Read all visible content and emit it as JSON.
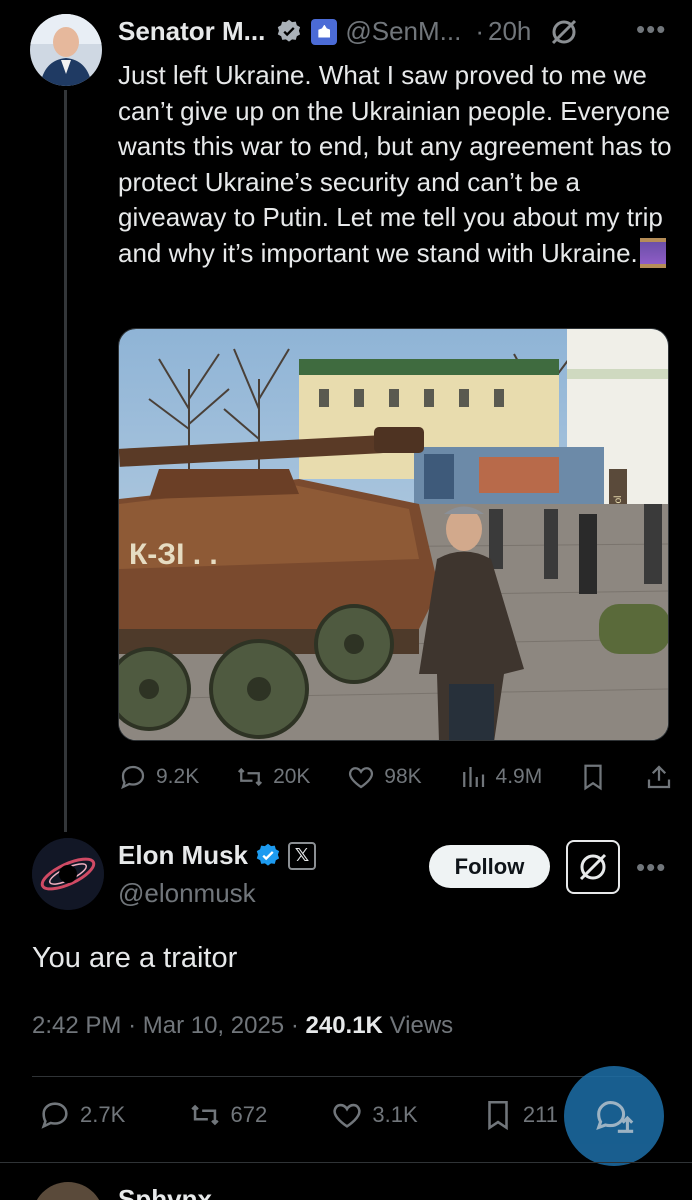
{
  "tweet": {
    "author_name": "Senator M...",
    "handle": "@SenM...",
    "time": "20h",
    "text": "Just left Ukraine. What I saw proved to me we can’t give up on the Ukrainian people. Everyone wants this war to end, but any agreement has to protect Ukraine’s security and can’t be a giveaway to Putin. Let me tell you about my trip and why it’s important we stand with Ukraine.",
    "media_sign": "Mariupol",
    "stats": {
      "replies": "9.2K",
      "reposts": "20K",
      "likes": "98K",
      "views": "4.9M"
    }
  },
  "reply": {
    "author_name": "Elon Musk",
    "x_badge": "𝕏",
    "handle": "@elonmusk",
    "follow_label": "Follow",
    "text": "You are a traitor",
    "time": "2:42 PM",
    "date": "Mar 10, 2025",
    "views_count": "240.1K",
    "views_label": "Views",
    "stats": {
      "replies": "2.7K",
      "reposts": "672",
      "likes": "3.1K",
      "bookmarks": "211"
    }
  },
  "next_tweet": {
    "author_name": "Sphvnx"
  },
  "colors": {
    "background": "#000000",
    "text": "#e7e9ea",
    "muted": "#71767b",
    "verified_blue": "#1d9bf0",
    "fab_blue": "#1d6fa8"
  },
  "icons": [
    "verified-icon",
    "gov-badge-icon",
    "grok-icon",
    "more-icon",
    "reply-icon",
    "repost-icon",
    "like-icon",
    "views-icon",
    "bookmark-icon",
    "share-icon",
    "compose-reply-icon"
  ]
}
